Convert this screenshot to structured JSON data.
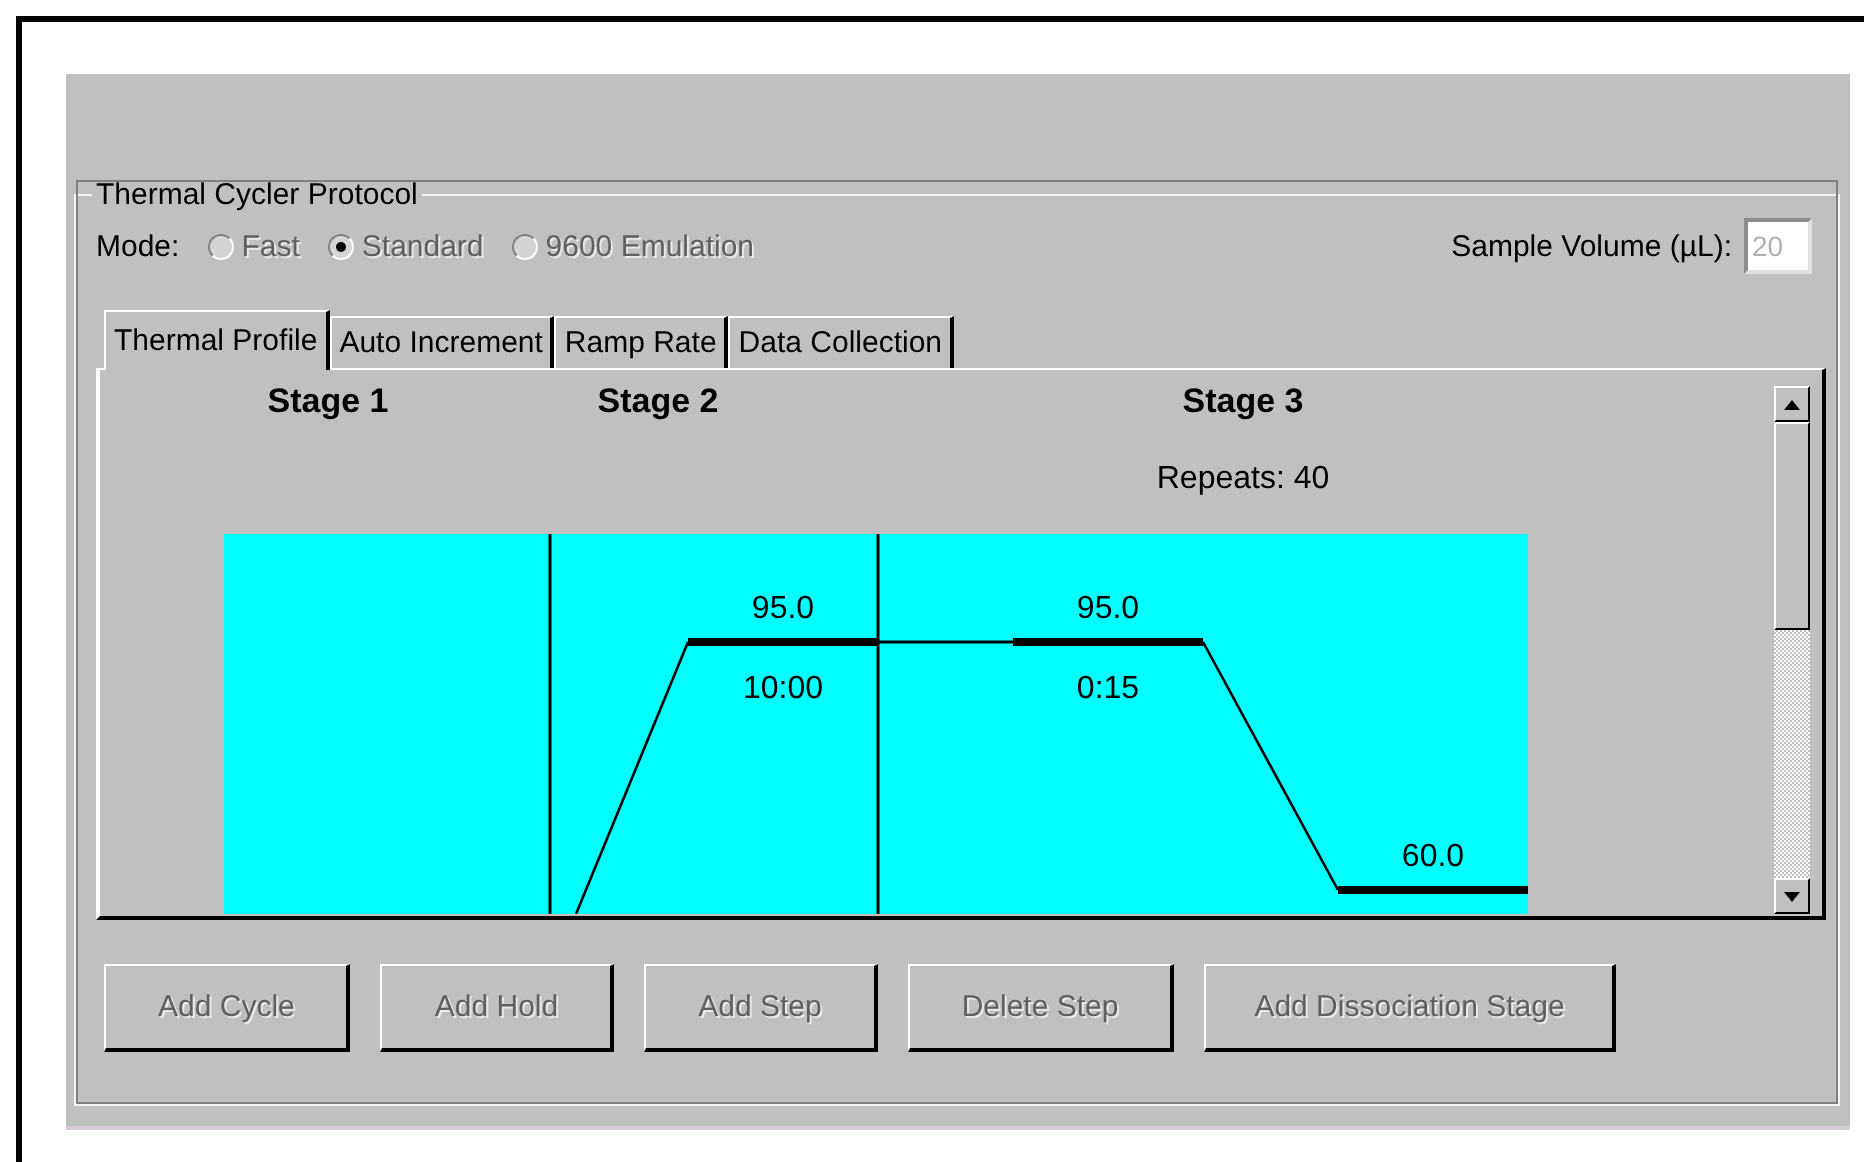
{
  "group_title": "Thermal Cycler Protocol",
  "mode": {
    "label": "Mode:",
    "disabled": true,
    "options": [
      {
        "label": "Fast",
        "selected": false
      },
      {
        "label": "Standard",
        "selected": true
      },
      {
        "label": "9600 Emulation",
        "selected": false
      }
    ]
  },
  "sample_volume": {
    "label": "Sample Volume (µL):",
    "value": "20",
    "disabled": true
  },
  "tabs": [
    {
      "label": "Thermal Profile",
      "selected": true
    },
    {
      "label": "Auto Increment",
      "selected": false
    },
    {
      "label": "Ramp Rate",
      "selected": false
    },
    {
      "label": "Data Collection",
      "selected": false
    }
  ],
  "stages": [
    {
      "title": "Stage 1"
    },
    {
      "title": "Stage 2",
      "steps": [
        {
          "temperature": "95.0",
          "time": "10:00"
        }
      ]
    },
    {
      "title": "Stage 3",
      "repeats": "Repeats: 40",
      "steps": [
        {
          "temperature": "95.0",
          "time": "0:15"
        },
        {
          "temperature": "60.0"
        }
      ]
    }
  ],
  "buttons": [
    {
      "label": "Add Cycle",
      "disabled": true
    },
    {
      "label": "Add Hold",
      "disabled": true
    },
    {
      "label": "Add Step",
      "disabled": true
    },
    {
      "label": "Delete Step",
      "disabled": true
    },
    {
      "label": "Add Dissociation Stage",
      "disabled": true
    }
  ]
}
